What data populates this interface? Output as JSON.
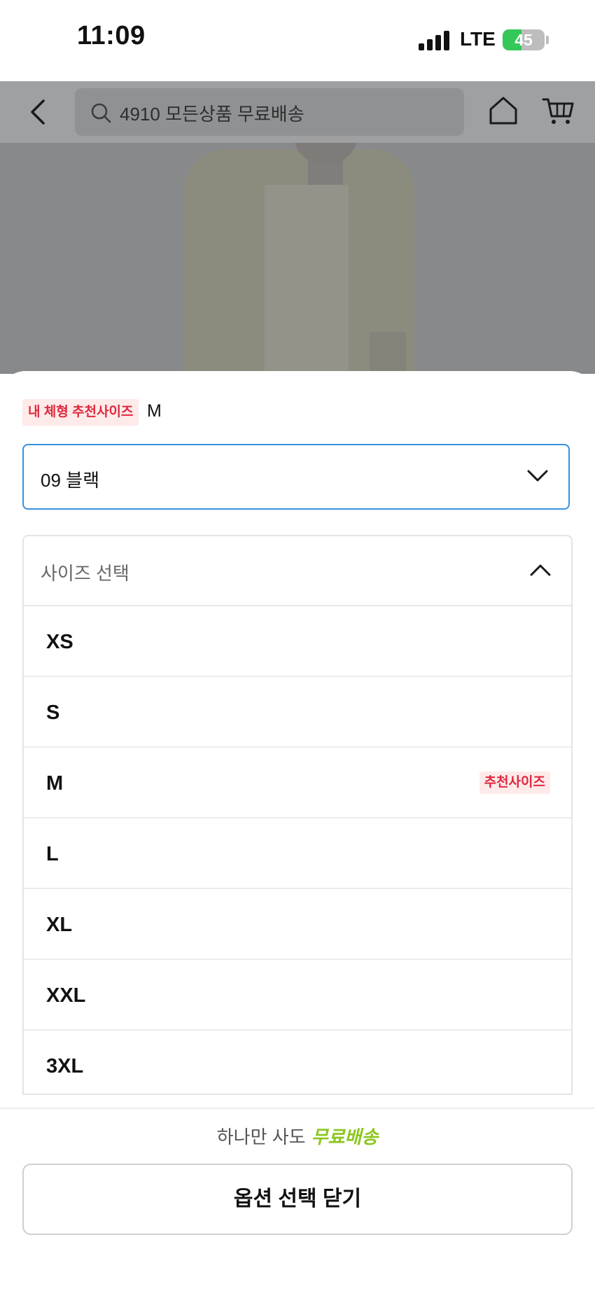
{
  "status_bar": {
    "time": "11:09",
    "network": "LTE",
    "battery": "45",
    "battery_level": 0.45,
    "battery_color": "#34c759"
  },
  "header": {
    "search_placeholder": "4910 모든상품 무료배송",
    "icons": [
      "back-arrow-icon",
      "search-icon",
      "home-icon",
      "cart-icon"
    ]
  },
  "sheet": {
    "recommend_tag": "내 체형 추천사이즈",
    "recommend_size": "M",
    "color_select": {
      "value": "09 블랙",
      "accent": "#3a8fe0"
    },
    "size_select": {
      "label": "사이즈 선택",
      "expanded": true,
      "options": [
        {
          "name": "XS",
          "badge": ""
        },
        {
          "name": "S",
          "badge": ""
        },
        {
          "name": "M",
          "badge": "추천사이즈"
        },
        {
          "name": "L",
          "badge": ""
        },
        {
          "name": "XL",
          "badge": ""
        },
        {
          "name": "XXL",
          "badge": ""
        },
        {
          "name": "3XL",
          "badge": ""
        }
      ]
    }
  },
  "footer": {
    "promo_text": "하나만 사도",
    "promo_highlight": "무료배송",
    "promo_color": "#8bc61f",
    "close_button": "옵션 선택 닫기"
  }
}
